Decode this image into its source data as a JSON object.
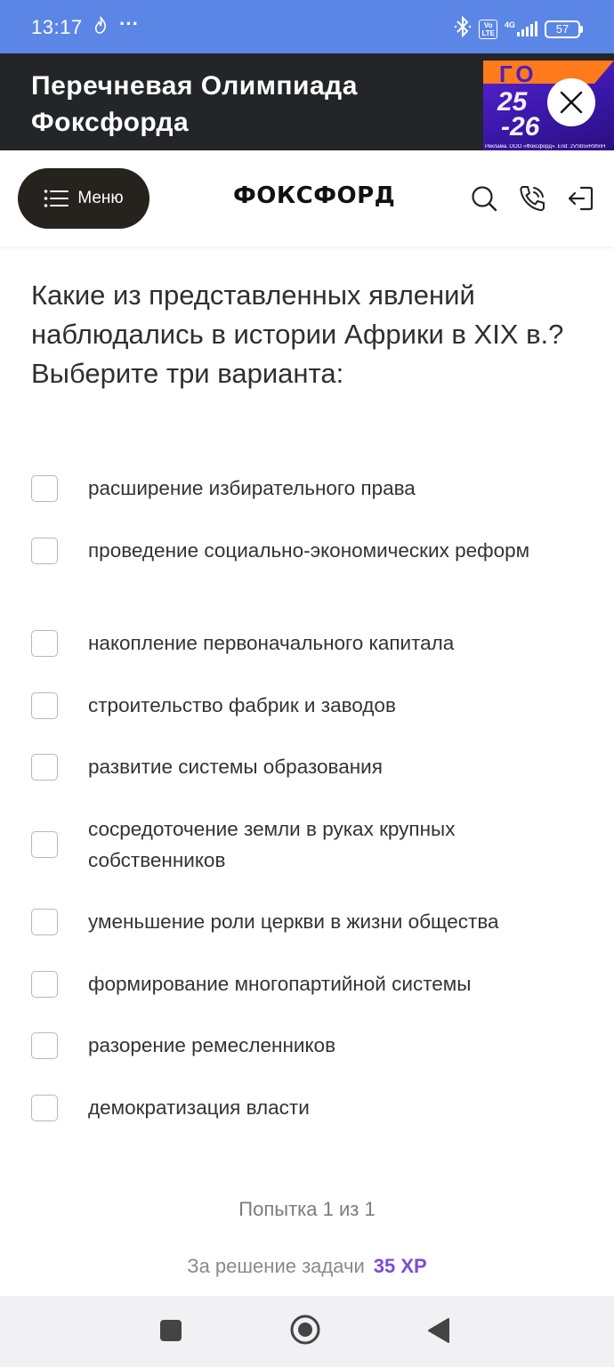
{
  "status_bar": {
    "time": "13:17",
    "dots": "···",
    "volte_line1": "Vo",
    "volte_line2": "LTE",
    "network": "4G",
    "battery": "57"
  },
  "ad": {
    "title_line1": "Перечневая Олимпиада",
    "title_line2": "Фоксфорда",
    "image_text_top": "ГО",
    "image_text_1": "25",
    "image_text_2": "-26",
    "image_disclaimer": "Реклама. ООО «Фоксфорд». Erid: 2VSb5xR9hnH"
  },
  "header": {
    "menu_label": "Меню",
    "logo": "ФОКСФОРД"
  },
  "question": {
    "text": "Какие из представленных явлений наблюдались в истории Африки в XIX в.? Выберите три варианта:"
  },
  "options": [
    {
      "label": "расширение избирательного права",
      "checked": false
    },
    {
      "label": "проведение социально-экономических реформ",
      "checked": false
    },
    {
      "label": "накопление первоначального капитала",
      "checked": false
    },
    {
      "label": "строительство фабрик и заводов",
      "checked": false
    },
    {
      "label": "развитие системы образования",
      "checked": false
    },
    {
      "label": "сосредоточение земли в руках крупных собственников",
      "checked": false
    },
    {
      "label": "уменьшение роли церкви в жизни общества",
      "checked": false
    },
    {
      "label": "формирование многопартийной системы",
      "checked": false
    },
    {
      "label": "разорение ремесленников",
      "checked": false
    },
    {
      "label": "демократизация власти",
      "checked": false
    }
  ],
  "footer": {
    "attempt": "Попытка 1 из 1",
    "reward_label": "За решение задачи",
    "reward_value": "35 XP"
  },
  "colors": {
    "status_bar": "#5b86e6",
    "ad_background": "#232528",
    "menu_button": "#26221e",
    "xp_accent": "#7b4cd8"
  },
  "icons": {
    "header": [
      "search-icon",
      "phone-icon",
      "login-icon"
    ],
    "nav": [
      "recents-icon",
      "home-icon",
      "back-icon"
    ]
  }
}
